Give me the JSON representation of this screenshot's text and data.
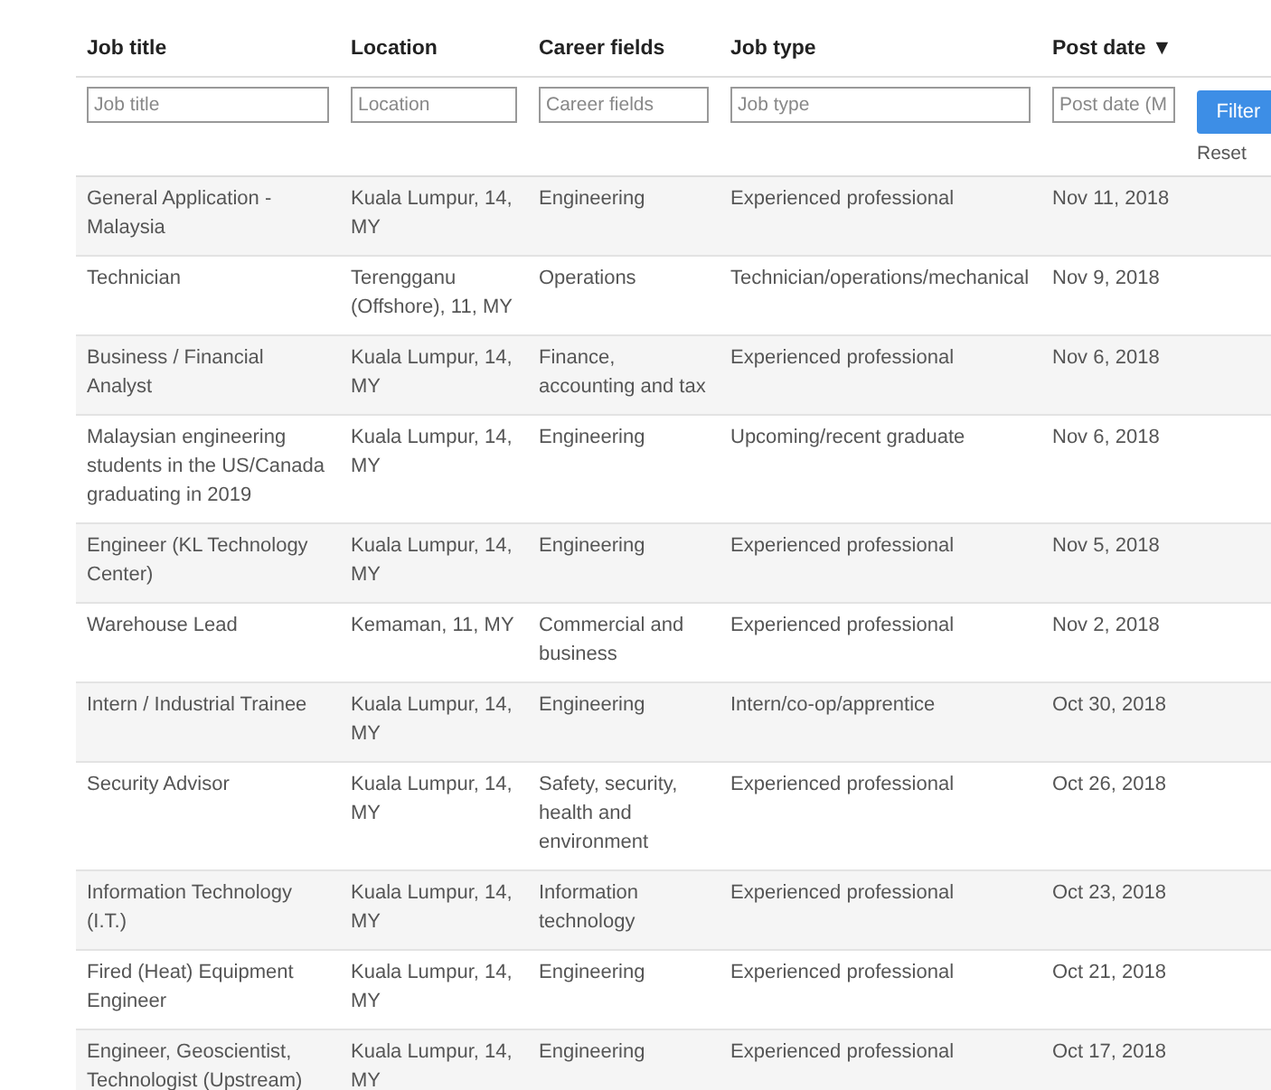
{
  "table": {
    "columns": [
      {
        "label": "Job title"
      },
      {
        "label": "Location"
      },
      {
        "label": "Career fields"
      },
      {
        "label": "Job type"
      },
      {
        "label": "Post date",
        "sort_indicator": "▼"
      }
    ],
    "filters": [
      {
        "placeholder": "Job title"
      },
      {
        "placeholder": "Location"
      },
      {
        "placeholder": "Career fields"
      },
      {
        "placeholder": "Job type"
      },
      {
        "placeholder": "Post date (M"
      }
    ],
    "filter_button": "Filter",
    "reset_link": "Reset",
    "rows": [
      [
        "General Application - Malaysia",
        "Kuala Lumpur, 14, MY",
        "Engineering",
        "Experienced professional",
        "Nov 11, 2018"
      ],
      [
        "Technician",
        "Terengganu (Offshore), 11, MY",
        "Operations",
        "Technician/operations/mechanical",
        "Nov 9, 2018"
      ],
      [
        "Business / Financial Analyst",
        "Kuala Lumpur, 14, MY",
        "Finance, accounting and tax",
        "Experienced professional",
        "Nov 6, 2018"
      ],
      [
        "Malaysian engineering students in the US/Canada graduating in 2019",
        "Kuala Lumpur, 14, MY",
        "Engineering",
        "Upcoming/recent graduate",
        "Nov 6, 2018"
      ],
      [
        "Engineer (KL Technology Center)",
        "Kuala Lumpur, 14, MY",
        "Engineering",
        "Experienced professional",
        "Nov 5, 2018"
      ],
      [
        "Warehouse Lead",
        "Kemaman, 11, MY",
        "Commercial and business",
        "Experienced professional",
        "Nov 2, 2018"
      ],
      [
        "Intern / Industrial Trainee",
        "Kuala Lumpur, 14, MY",
        "Engineering",
        "Intern/co-op/apprentice",
        "Oct 30, 2018"
      ],
      [
        "Security Advisor",
        "Kuala Lumpur, 14, MY",
        "Safety, security, health and environment",
        "Experienced professional",
        "Oct 26, 2018"
      ],
      [
        "Information Technology (I.T.)",
        "Kuala Lumpur, 14, MY",
        "Information technology",
        "Experienced professional",
        "Oct 23, 2018"
      ],
      [
        "Fired (Heat) Equipment Engineer",
        "Kuala Lumpur, 14, MY",
        "Engineering",
        "Experienced professional",
        "Oct 21, 2018"
      ],
      [
        "Engineer, Geoscientist, Technologist (Upstream)",
        "Kuala Lumpur, 14, MY",
        "Engineering",
        "Experienced professional",
        "Oct 17, 2018"
      ]
    ]
  }
}
